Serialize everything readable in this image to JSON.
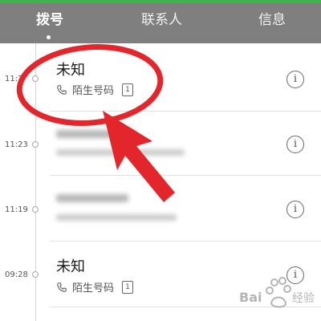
{
  "tabs": [
    {
      "label": "拨号",
      "active": true
    },
    {
      "label": "联系人",
      "active": false
    },
    {
      "label": "信息",
      "active": false
    }
  ],
  "calls": [
    {
      "time": "11:2",
      "name": "未知",
      "sub": "陌生号码",
      "sim": "1",
      "blurred": false
    },
    {
      "time": "11:23",
      "name": "",
      "sub": "",
      "sim": "",
      "blurred": true
    },
    {
      "time": "11:19",
      "name": "",
      "sub": "",
      "sim": "",
      "blurred": true
    },
    {
      "time": "09:28",
      "name": "未知",
      "sub": "陌生号码",
      "sim": "1",
      "blurred": false
    }
  ],
  "icons": {
    "phone": "phone-icon",
    "info": "info-icon",
    "sim": "sim-card-icon"
  },
  "colors": {
    "header_bg": "#7f7f7f",
    "accent_green": "#3fb34f",
    "annotation_red": "#e2262b"
  },
  "watermark": "Bai 经验"
}
